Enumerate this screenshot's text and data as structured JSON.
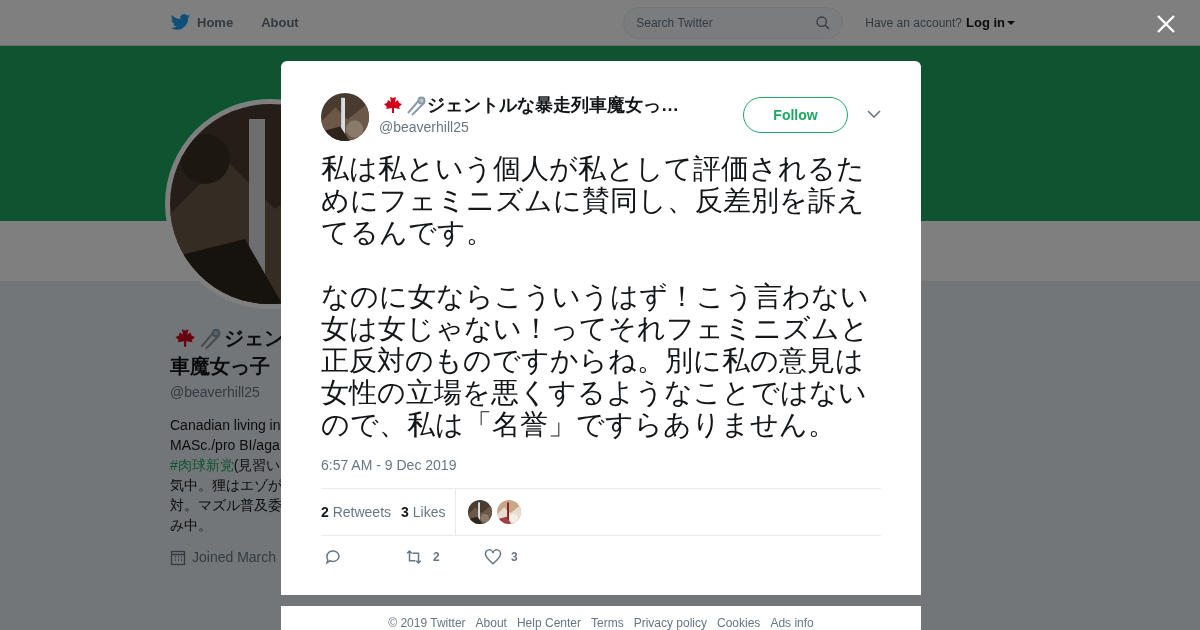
{
  "topbar": {
    "nav": [
      {
        "label": "Home"
      },
      {
        "label": "About"
      }
    ],
    "search": {
      "placeholder": "Search Twitter"
    },
    "account_prompt": "Have an account?",
    "login": "Log in"
  },
  "profile": {
    "name_lines": [
      "ジェン",
      "車魔女っ子"
    ],
    "handle": "@beaverhill25",
    "bio": [
      {
        "text": "Canadian living in"
      },
      {
        "text": "MASc./pro BI/aga"
      },
      {
        "hashtag": "#肉球新党",
        "text": "(見習い"
      },
      {
        "text": "気中。狸はエゾが"
      },
      {
        "text": "対。マズル普及委"
      },
      {
        "text": "み中。"
      }
    ],
    "joined": "Joined March"
  },
  "tweet": {
    "name": "ジェントルな暴走列車魔女っ…",
    "handle": "@beaverhill25",
    "follow": "Follow",
    "paragraphs": [
      "私は私という個人が私として評価されるためにフェミニズムに賛同し、反差別を訴えてるんです。",
      "なのに女ならこういうはず！こう言わない女は女じゃない！ってそれフェミニズムと正反対のものですからね。別に私の意見は女性の立場を悪くするようなことではないので、私は「名誉」ですらありません。"
    ],
    "time": "6:57 AM - 9 Dec 2019",
    "stats": [
      {
        "count": "2",
        "label": "Retweets"
      },
      {
        "count": "3",
        "label": "Likes"
      }
    ],
    "likers": [
      {
        "kind": "picture"
      },
      {
        "kind": "picture"
      }
    ],
    "actions": [
      {
        "kind": "reply"
      },
      {
        "kind": "retweet",
        "count": "2"
      },
      {
        "kind": "like",
        "count": "3"
      }
    ]
  },
  "footer": [
    "© 2019 Twitter",
    "About",
    "Help Center",
    "Terms",
    "Privacy policy",
    "Cookies",
    "Ads info"
  ]
}
